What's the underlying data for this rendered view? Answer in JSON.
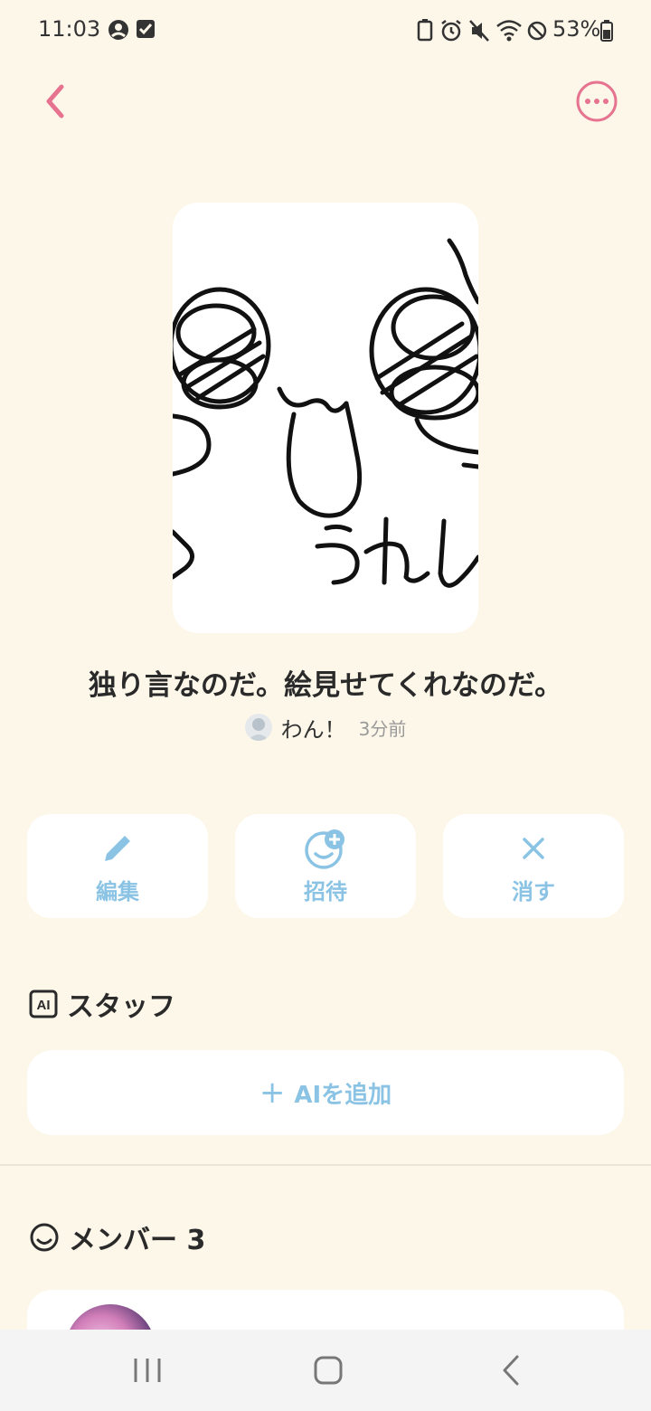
{
  "status_bar": {
    "time": "11:03",
    "battery": "53%"
  },
  "post": {
    "title": "独り言なのだ。絵見せてくれなのだ。",
    "author": "わん！",
    "time_ago": "3分前",
    "drawing_text": "うれし"
  },
  "actions": {
    "edit_label": "編集",
    "invite_label": "招待",
    "delete_label": "消す"
  },
  "staff": {
    "heading": "スタッフ",
    "badge": "AI",
    "add_ai_label": "AIを追加",
    "add_ai_plus": "+"
  },
  "members": {
    "heading": "メンバー 3"
  },
  "colors": {
    "background": "#fdf7e9",
    "accent_pink": "#e6738f",
    "accent_blue": "#8ac3e4"
  }
}
